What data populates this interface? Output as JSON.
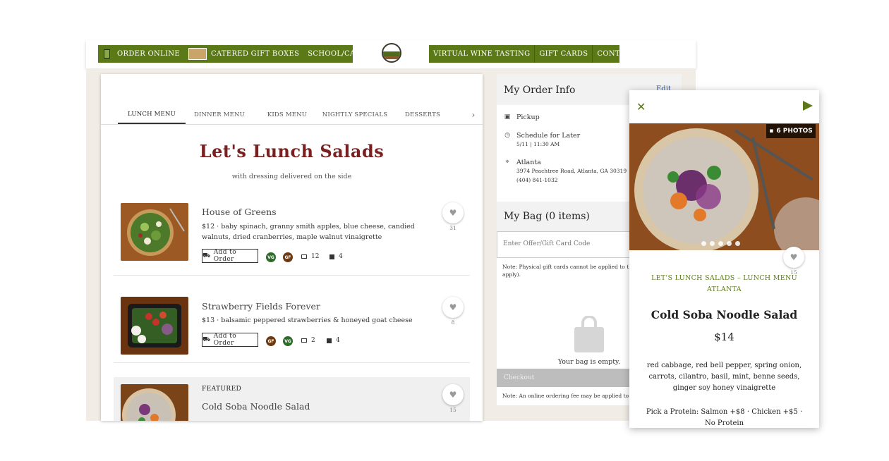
{
  "nav": {
    "left_items": [
      "ORDER ONLINE",
      "CATERED GIFT BOXES",
      "SCHOOL/CATERING"
    ],
    "right_items": [
      "VIRTUAL WINE TASTING",
      "GIFT CARDS",
      "CONTACT US"
    ],
    "accent_color": "#5b7a17"
  },
  "menu": {
    "tabs": [
      "LUNCH MENU",
      "DINNER MENU",
      "KIDS MENU",
      "NIGHTLY SPECIALS",
      "DESSERTS"
    ],
    "active_tab": "LUNCH MENU",
    "title": "Let's Lunch Salads",
    "subtitle": "with dressing delivered on the side",
    "add_label": "Add to Order",
    "items": [
      {
        "name": "House of Greens",
        "desc": "$12 · baby spinach, granny smith apples, blue cheese, candied walnuts, dried cranberries, maple walnut vinaigrette",
        "badges": [
          "VG",
          "GF"
        ],
        "reviews": "12",
        "photos": "4",
        "likes": "31"
      },
      {
        "name": "Strawberry Fields Forever",
        "desc": "$13 · balsamic peppered strawberries & honeyed goat cheese",
        "badges": [
          "GF",
          "VG"
        ],
        "reviews": "2",
        "photos": "4",
        "likes": "8"
      },
      {
        "featured_label": "FEATURED",
        "name": "Cold Soba Noodle Salad",
        "likes": "15"
      }
    ]
  },
  "order": {
    "title": "My Order Info",
    "edit": "Edit",
    "method": "Pickup",
    "schedule": "Schedule for Later",
    "schedule_time": "5/11 | 11:30 AM",
    "location": "Atlanta",
    "address": "3974 Peachtree Road, Atlanta, GA 30319",
    "phone": "(404) 841-1032",
    "bag_title": "My Bag (0 items)",
    "offer_placeholder": "Enter Offer/Gift Card Code",
    "gift_note": "Note: Physical gift cards cannot be applied to this gift cards apply).",
    "empty": "Your bag is empty.",
    "checkout": "Checkout",
    "fee_note": "Note: An online ordering fee may be applied to th"
  },
  "detail": {
    "photos_label": "6 PHOTOS",
    "category": "LET'S LUNCH SALADS – LUNCH MENU",
    "location": "ATLANTA",
    "name": "Cold Soba Noodle Salad",
    "price": "$14",
    "likes": "15",
    "description": "red cabbage, red bell pepper, spring onion, carrots, cilantro, basil, mint, benne seeds, ginger soy honey vinaigrette",
    "protein_label": "Pick a Protein:",
    "protein_options": "Salmon +$8 · Chicken +$5 ·",
    "protein_none": "No Protein"
  }
}
